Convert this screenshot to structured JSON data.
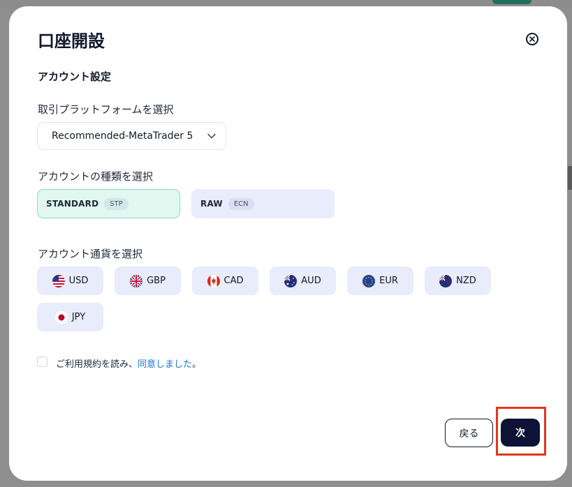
{
  "modal": {
    "title": "口座開設",
    "section_title": "アカウント設定"
  },
  "platform": {
    "label": "取引プラットフォームを選択",
    "selected": "Recommended-MetaTrader 5"
  },
  "account_type": {
    "label": "アカウントの種類を選択",
    "options": [
      {
        "name": "STANDARD",
        "badge": "STP",
        "selected": true
      },
      {
        "name": "RAW",
        "badge": "ECN",
        "selected": false
      }
    ]
  },
  "currency": {
    "label": "アカウント通貨を選択",
    "options": [
      {
        "code": "USD",
        "icon": "us-flag-icon"
      },
      {
        "code": "GBP",
        "icon": "uk-flag-icon"
      },
      {
        "code": "CAD",
        "icon": "canada-flag-icon"
      },
      {
        "code": "AUD",
        "icon": "australia-flag-icon"
      },
      {
        "code": "EUR",
        "icon": "eu-flag-icon"
      },
      {
        "code": "NZD",
        "icon": "new-zealand-flag-icon"
      },
      {
        "code": "JPY",
        "icon": "japan-flag-icon"
      }
    ]
  },
  "terms": {
    "prefix": "ご利用規約を読み、",
    "link": "同意しました",
    "suffix": "。",
    "checked": false
  },
  "buttons": {
    "back": "戻る",
    "next": "次"
  },
  "colors": {
    "selected_card_bg": "#e3f7f1",
    "selected_card_border": "#8ed8c4",
    "option_bg": "#e8ecfb",
    "primary_button": "#0d1236",
    "link": "#1e73c8",
    "highlight": "#e5341f"
  }
}
